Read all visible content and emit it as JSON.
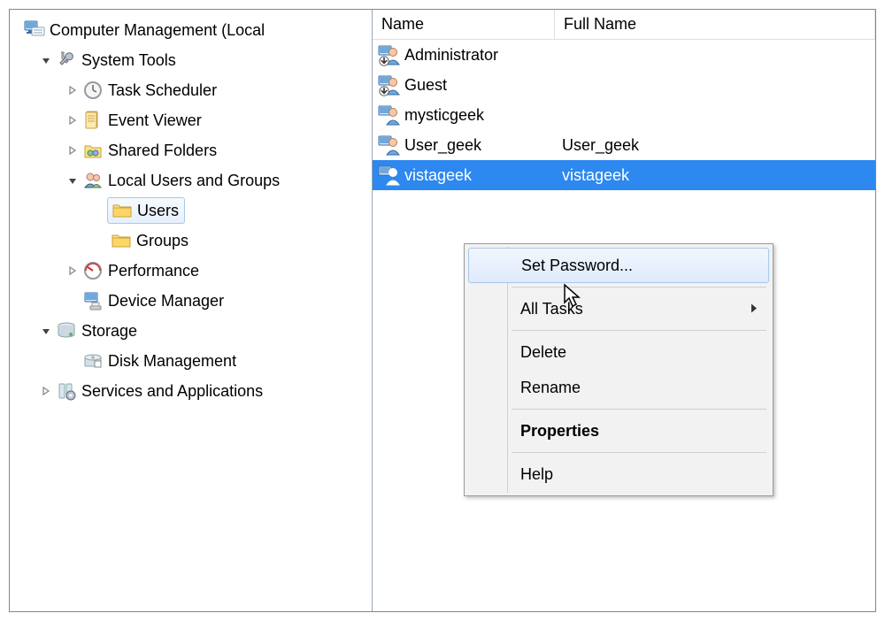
{
  "tree": {
    "root_label": "Computer Management (Local",
    "system_tools": "System Tools",
    "task_scheduler": "Task Scheduler",
    "event_viewer": "Event Viewer",
    "shared_folders": "Shared Folders",
    "local_users_groups": "Local Users and Groups",
    "users": "Users",
    "groups": "Groups",
    "performance": "Performance",
    "device_manager": "Device Manager",
    "storage": "Storage",
    "disk_management": "Disk Management",
    "services_apps": "Services and Applications"
  },
  "list": {
    "headers": {
      "name": "Name",
      "full_name": "Full Name"
    },
    "rows": [
      {
        "name": "Administrator",
        "full_name": "",
        "disabled": true
      },
      {
        "name": "Guest",
        "full_name": "",
        "disabled": true
      },
      {
        "name": "mysticgeek",
        "full_name": "",
        "disabled": false
      },
      {
        "name": "User_geek",
        "full_name": "User_geek",
        "disabled": false
      },
      {
        "name": "vistageek",
        "full_name": "vistageek",
        "disabled": false
      }
    ],
    "selected_index": 4
  },
  "context_menu": {
    "set_password": "Set Password...",
    "all_tasks": "All Tasks",
    "delete": "Delete",
    "rename": "Rename",
    "properties": "Properties",
    "help": "Help"
  }
}
